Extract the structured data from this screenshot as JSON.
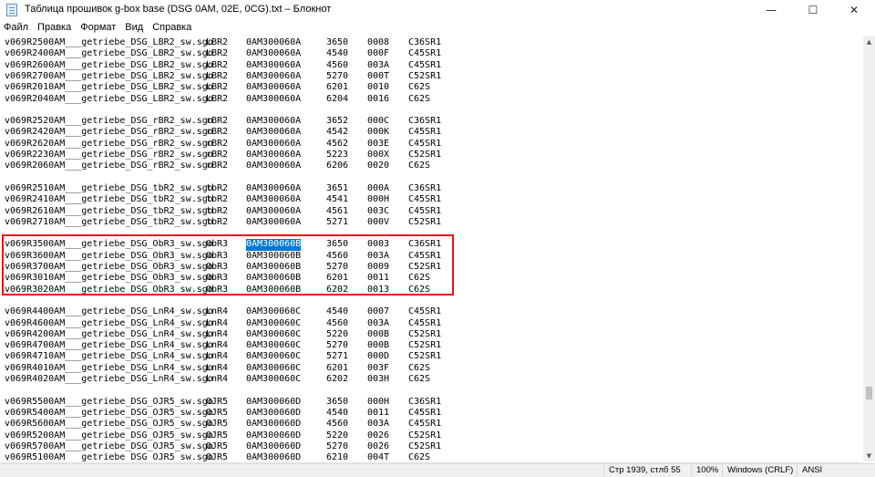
{
  "window": {
    "title": "Таблица прошивок g-box base (DSG 0AM, 02E, 0CG).txt – Блокнот",
    "minimize_glyph": "—",
    "maximize_glyph": "☐",
    "close_glyph": "✕"
  },
  "menu": {
    "items": [
      "Файл",
      "Правка",
      "Формат",
      "Вид",
      "Справка"
    ]
  },
  "editor": {
    "lines": [
      [
        "v069R2500AM___getriebe_DSG_LBR2_sw.sgo",
        "LBR2",
        "0AM300060A",
        "3650",
        "0008",
        "C36SR1"
      ],
      [
        "v069R2400AM___getriebe_DSG_LBR2_sw.sgo",
        "LBR2",
        "0AM300060A",
        "4540",
        "000F",
        "C45SR1"
      ],
      [
        "v069R2600AM___getriebe_DSG_LBR2_sw.sgo",
        "LBR2",
        "0AM300060A",
        "4560",
        "003A",
        "C45SR1"
      ],
      [
        "v069R2700AM___getriebe_DSG_LBR2_sw.sgo",
        "LBR2",
        "0AM300060A",
        "5270",
        "000T",
        "C52SR1"
      ],
      [
        "v069R2010AM___getriebe_DSG_LBR2_sw.sgo",
        "LBR2",
        "0AM300060A",
        "6201",
        "0010",
        "C62S"
      ],
      [
        "v069R2040AM___getriebe_DSG_LBR2_sw.sgo",
        "LBR2",
        "0AM300060A",
        "6204",
        "0016",
        "C62S"
      ],
      [],
      [
        "v069R2520AM___getriebe_DSG_rBR2_sw.sgo",
        "rBR2",
        "0AM300060A",
        "3652",
        "000C",
        "C36SR1"
      ],
      [
        "v069R2420AM___getriebe_DSG_rBR2_sw.sgo",
        "rBR2",
        "0AM300060A",
        "4542",
        "000K",
        "C45SR1"
      ],
      [
        "v069R2620AM___getriebe_DSG_rBR2_sw.sgo",
        "rBR2",
        "0AM300060A",
        "4562",
        "003E",
        "C45SR1"
      ],
      [
        "v069R2230AM___getriebe_DSG_rBR2_sw.sgo",
        "rBR2",
        "0AM300060A",
        "5223",
        "000X",
        "C52SR1"
      ],
      [
        "v069R2060AM___getriebe_DSG_rBR2_sw.sgo",
        "rBR2",
        "0AM300060A",
        "6206",
        "0020",
        "C62S"
      ],
      [],
      [
        "v069R2510AM___getriebe_DSG_tbR2_sw.sgo",
        "tbR2",
        "0AM300060A",
        "3651",
        "000A",
        "C36SR1"
      ],
      [
        "v069R2410AM___getriebe_DSG_tbR2_sw.sgo",
        "tbR2",
        "0AM300060A",
        "4541",
        "000H",
        "C45SR1"
      ],
      [
        "v069R2610AM___getriebe_DSG_tbR2_sw.sgo",
        "tbR2",
        "0AM300060A",
        "4561",
        "003C",
        "C45SR1"
      ],
      [
        "v069R2710AM___getriebe_DSG_tbR2_sw.sgo",
        "tbR2",
        "0AM300060A",
        "5271",
        "000V",
        "C52SR1"
      ],
      [],
      [
        "v069R3500AM___getriebe_DSG_ObR3_sw.sgo",
        "ObR3",
        "0AM300060B",
        "3650",
        "0003",
        "C36SR1"
      ],
      [
        "v069R3600AM___getriebe_DSG_ObR3_sw.sgo",
        "ObR3",
        "0AM300060B",
        "4560",
        "003A",
        "C45SR1"
      ],
      [
        "v069R3700AM___getriebe_DSG_ObR3_sw.sgo",
        "ObR3",
        "0AM300060B",
        "5270",
        "0009",
        "C52SR1"
      ],
      [
        "v069R3010AM___getriebe_DSG_ObR3_sw.sgo",
        "ObR3",
        "0AM300060B",
        "6201",
        "0011",
        "C62S"
      ],
      [
        "v069R3020AM___getriebe_DSG_ObR3_sw.sgo",
        "ObR3",
        "0AM300060B",
        "6202",
        "0013",
        "C62S"
      ],
      [],
      [
        "v069R4400AM___getriebe_DSG_LnR4_sw.sgo",
        "LnR4",
        "0AM300060C",
        "4540",
        "0007",
        "C45SR1"
      ],
      [
        "v069R4600AM___getriebe_DSG_LnR4_sw.sgo",
        "LnR4",
        "0AM300060C",
        "4560",
        "003A",
        "C45SR1"
      ],
      [
        "v069R4200AM___getriebe_DSG_LnR4_sw.sgo",
        "LnR4",
        "0AM300060C",
        "5220",
        "000B",
        "C52SR1"
      ],
      [
        "v069R4700AM___getriebe_DSG_LnR4_sw.sgo",
        "LnR4",
        "0AM300060C",
        "5270",
        "000B",
        "C52SR1"
      ],
      [
        "v069R4710AM___getriebe_DSG_LnR4_sw.sgo",
        "LnR4",
        "0AM300060C",
        "5271",
        "000D",
        "C52SR1"
      ],
      [
        "v069R4010AM___getriebe_DSG_LnR4_sw.sgo",
        "LnR4",
        "0AM300060C",
        "6201",
        "003F",
        "C62S"
      ],
      [
        "v069R4020AM___getriebe_DSG_LnR4_sw.sgo",
        "LnR4",
        "0AM300060C",
        "6202",
        "003H",
        "C62S"
      ],
      [],
      [
        "v069R5500AM___getriebe_DSG_OJR5_sw.sgo",
        "OJR5",
        "0AM300060D",
        "3650",
        "000H",
        "C36SR1"
      ],
      [
        "v069R5400AM___getriebe_DSG_OJR5_sw.sgo",
        "OJR5",
        "0AM300060D",
        "4540",
        "0011",
        "C45SR1"
      ],
      [
        "v069R5600AM___getriebe_DSG_OJR5_sw.sgo",
        "OJR5",
        "0AM300060D",
        "4560",
        "003A",
        "C45SR1"
      ],
      [
        "v069R5200AM___getriebe_DSG_OJR5_sw.sgo",
        "OJR5",
        "0AM300060D",
        "5220",
        "0026",
        "C52SR1"
      ],
      [
        "v069R5700AM___getriebe_DSG_OJR5_sw.sgo",
        "OJR5",
        "0AM300060D",
        "5270",
        "0026",
        "C52SR1"
      ],
      [
        "v069R5100AM___getriebe_DSG_OJR5_sw.sgo",
        "OJR5",
        "0AM300060D",
        "6210",
        "004T",
        "C62S"
      ]
    ],
    "selected_text": {
      "line": 18,
      "column": 2
    },
    "highlight_colors": {
      "selection_bg": "#0078d7",
      "box_border": "#e8121a"
    }
  },
  "scrollbar": {
    "up_glyph": "▲",
    "down_glyph": "▼"
  },
  "status": {
    "position": "Стр 1939, стлб 55",
    "zoom": "100%",
    "line_ending": "Windows (CRLF)",
    "encoding": "ANSI"
  }
}
